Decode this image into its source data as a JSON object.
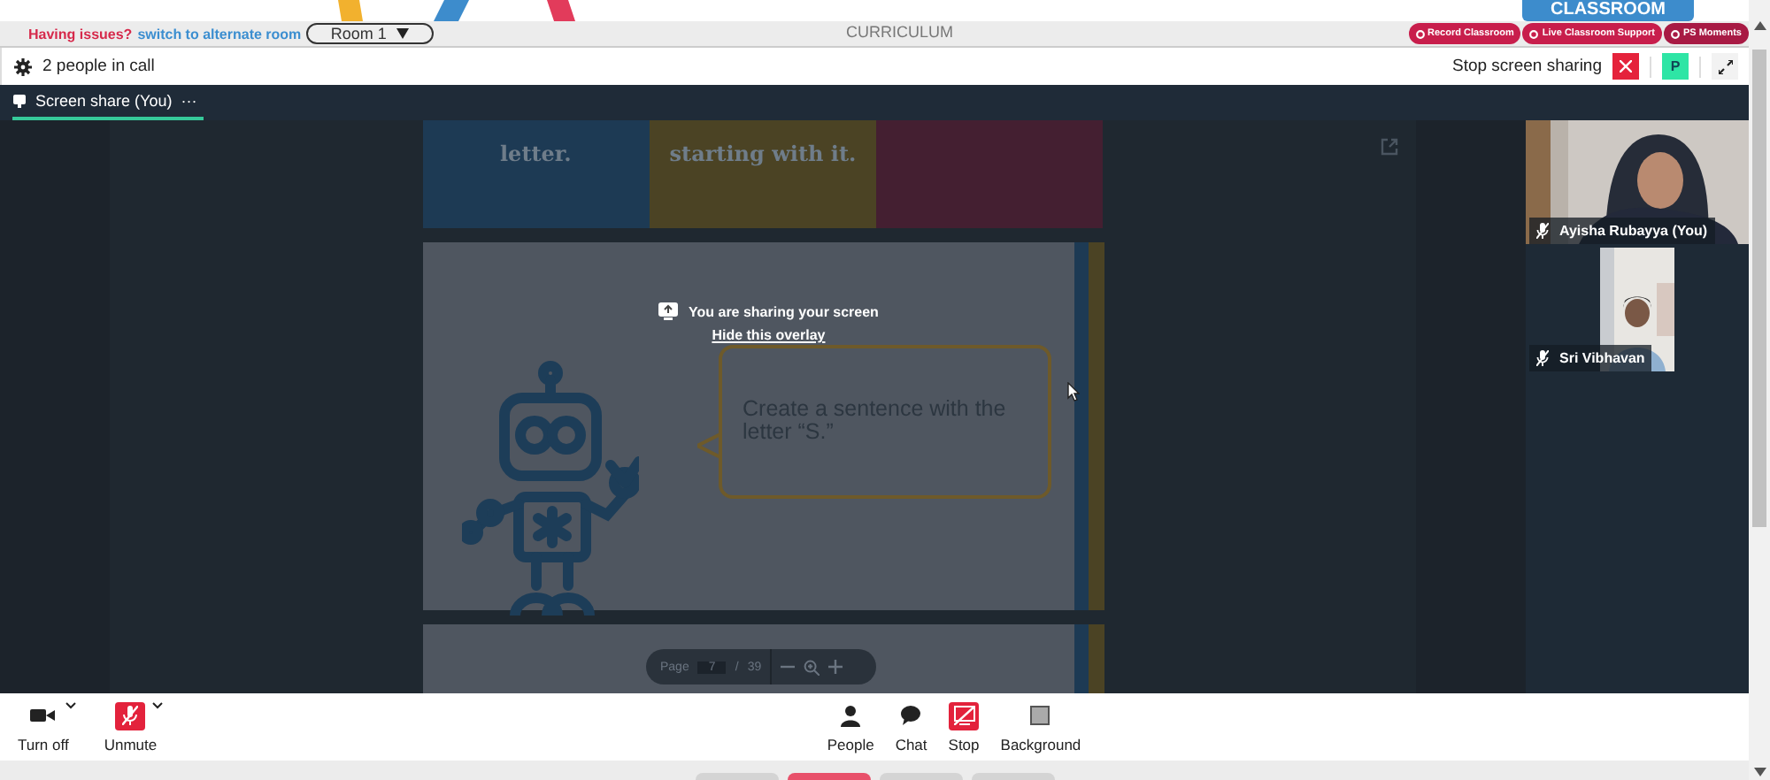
{
  "banner": {
    "label": "CLASSROOM"
  },
  "top_bar": {
    "issue_text": "Having issues?",
    "switch_link": "switch to alternate room",
    "room_select": "Room 1",
    "title": "CURRICULUM",
    "buttons": [
      {
        "label": "Record Classroom"
      },
      {
        "label": "Live Classroom Support"
      },
      {
        "label": "PS Moments"
      }
    ]
  },
  "call_bar": {
    "people_count": "2 people in call",
    "stop_label": "Stop screen sharing",
    "avatar": "P"
  },
  "share_tab": {
    "label": "Screen share (You)",
    "menu": "···",
    "selected": true
  },
  "slide": {
    "panels": [
      {
        "text": "letter.",
        "color": "#1d3a54"
      },
      {
        "text": "starting with it.",
        "color": "#4b4324"
      },
      {
        "color": "#441f31"
      }
    ],
    "bubble": "Create a sentence with the letter “S.”"
  },
  "overlay": {
    "message": "You are sharing your screen",
    "hide_link": "Hide this overlay"
  },
  "pager": {
    "label": "Page",
    "page": "7",
    "separator": "/",
    "total": "39"
  },
  "bottom_tabs": [
    {
      "selected": false
    },
    {
      "selected": true
    },
    {
      "selected": false
    },
    {
      "selected": false
    }
  ],
  "participants": [
    {
      "name": "Ayisha Rubayya (You)",
      "muted": true
    },
    {
      "name": "Sri Vibhavan",
      "muted": true
    }
  ],
  "controls": [
    {
      "label": "Turn off",
      "kind": "camera",
      "dropdown": true,
      "alert": false
    },
    {
      "label": "Unmute",
      "kind": "mic",
      "dropdown": true,
      "alert": true
    },
    {
      "label": "People",
      "kind": "people",
      "dropdown": false,
      "alert": false
    },
    {
      "label": "Chat",
      "kind": "chat",
      "dropdown": false,
      "alert": false
    },
    {
      "label": "Stop",
      "kind": "stop",
      "dropdown": false,
      "alert": true
    },
    {
      "label": "Background",
      "kind": "background",
      "dropdown": false,
      "alert": false
    }
  ]
}
